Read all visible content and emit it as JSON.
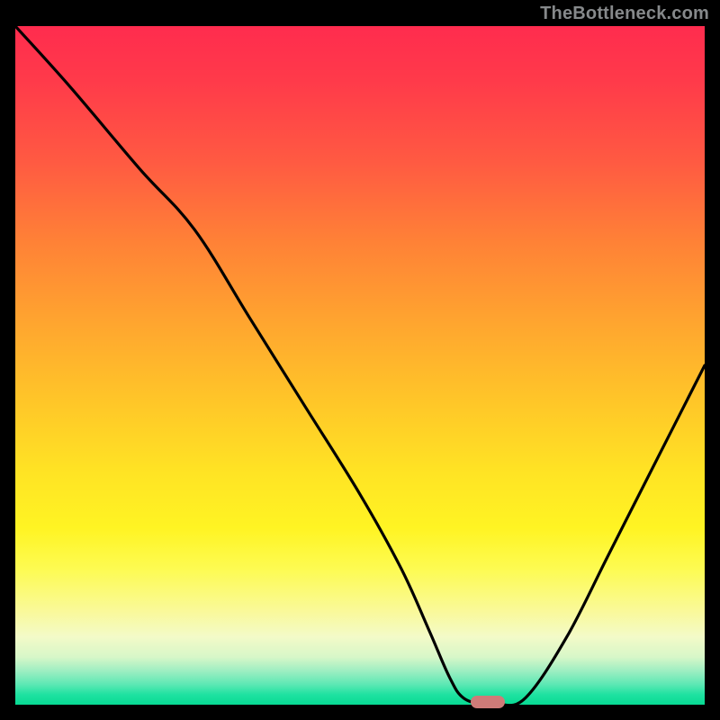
{
  "watermark": "TheBottleneck.com",
  "chart_data": {
    "type": "line",
    "title": "",
    "xlabel": "",
    "ylabel": "",
    "xlim": [
      0,
      100
    ],
    "ylim": [
      0,
      100
    ],
    "x": [
      0,
      8,
      18,
      26,
      34,
      42,
      50,
      56,
      60,
      63,
      65,
      68,
      70,
      74,
      80,
      86,
      92,
      100
    ],
    "values": [
      100,
      91,
      79,
      70,
      57,
      44,
      31,
      20,
      11,
      4,
      1,
      0,
      0,
      1,
      10,
      22,
      34,
      50
    ],
    "marker": {
      "x": 68.5,
      "y": 0,
      "color": "#cf7b78"
    },
    "gradient_stops": [
      {
        "pos": 0,
        "color": "#ff2c4e"
      },
      {
        "pos": 50,
        "color": "#ffc828"
      },
      {
        "pos": 80,
        "color": "#fdfb52"
      },
      {
        "pos": 100,
        "color": "#07da93"
      }
    ]
  },
  "layout": {
    "plot_inner_w": 766,
    "plot_inner_h": 754
  }
}
